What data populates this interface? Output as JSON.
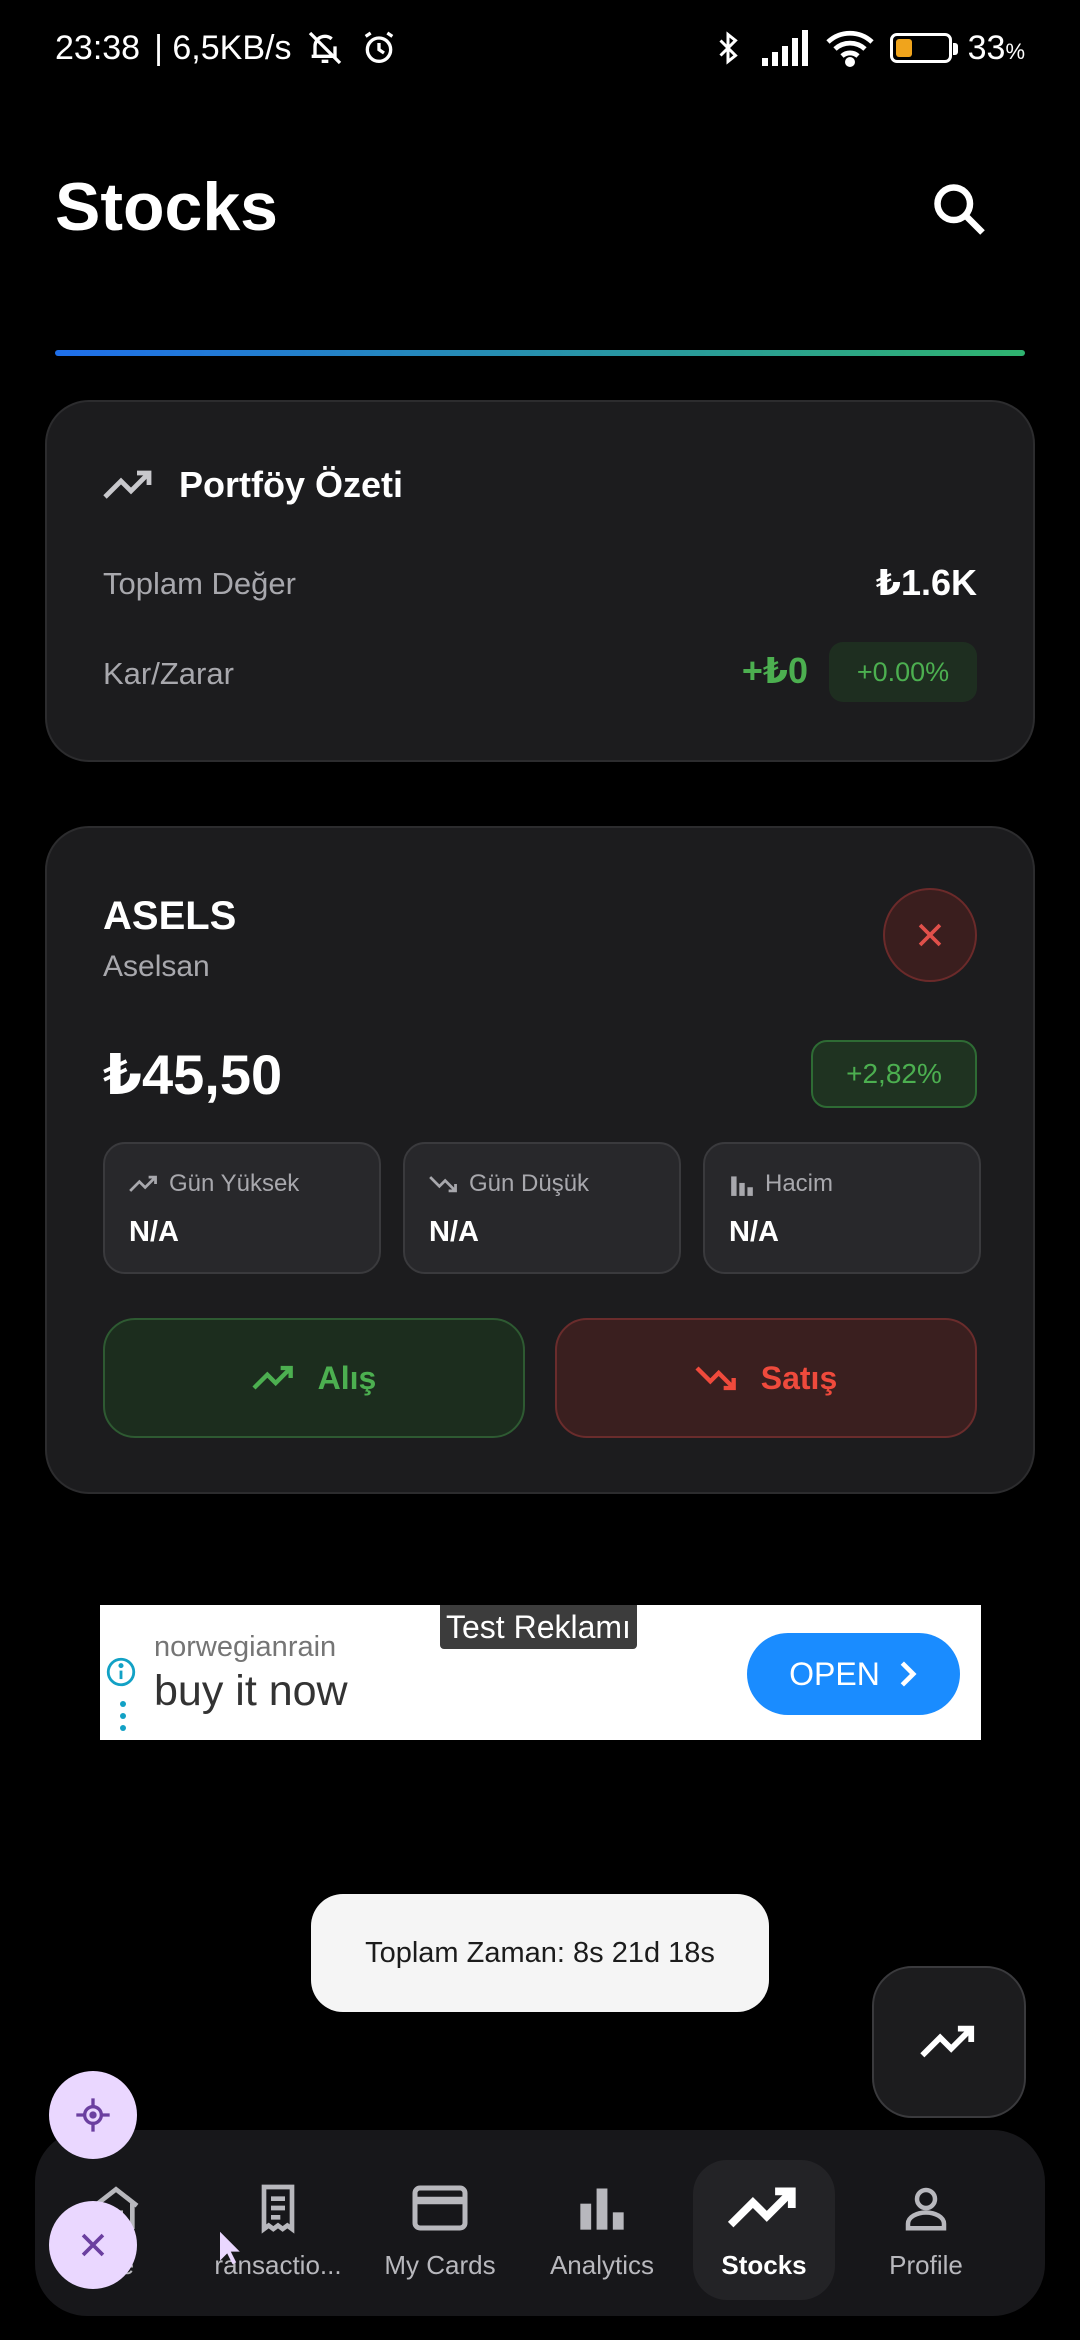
{
  "status_bar": {
    "time": "23:38",
    "net_speed": "| 6,5KB/s",
    "battery_pct": "33",
    "battery_unit": "%",
    "battery_level": 0.33,
    "battery_color": "#f0a41c"
  },
  "header": {
    "title": "Stocks",
    "search_icon": "search-icon",
    "accent_gradient": [
      "#1f6feb",
      "#2fb36f"
    ]
  },
  "portfolio": {
    "title": "Portföy Özeti",
    "total_label": "Toplam Değer",
    "total_value": "₺1.6K",
    "pnl_label": "Kar/Zarar",
    "pnl_value": "+₺0",
    "pnl_pct": "+0.00%"
  },
  "stock": {
    "symbol": "ASELS",
    "name": "Aselsan",
    "price": "₺45,50",
    "change_pct": "+2,82%",
    "stats": [
      {
        "label": "Gün Yüksek",
        "value": "N/A",
        "icon": "trend-up-icon"
      },
      {
        "label": "Gün Düşük",
        "value": "N/A",
        "icon": "trend-down-icon"
      },
      {
        "label": "Hacim",
        "value": "N/A",
        "icon": "bar-chart-icon"
      }
    ],
    "buy_label": "Alış",
    "sell_label": "Satış"
  },
  "ad": {
    "tag": "Test Reklamı",
    "advertiser": "norwegianrain",
    "headline": "buy it now",
    "button": "OPEN"
  },
  "toast": {
    "text": "Toplam Zaman: 8s 21d 18s"
  },
  "nav": {
    "items": [
      {
        "label": "me",
        "icon": "home-icon"
      },
      {
        "label": "ransactio...",
        "icon": "receipt-icon"
      },
      {
        "label": "My Cards",
        "icon": "card-icon"
      },
      {
        "label": "Analytics",
        "icon": "bar-chart-icon"
      },
      {
        "label": "Stocks",
        "icon": "trend-up-icon",
        "active": true
      },
      {
        "label": "Profile",
        "icon": "person-icon"
      }
    ]
  },
  "colors": {
    "positive": "#4caf50",
    "negative": "#ef4a3c",
    "ad_button": "#1a8cff"
  }
}
